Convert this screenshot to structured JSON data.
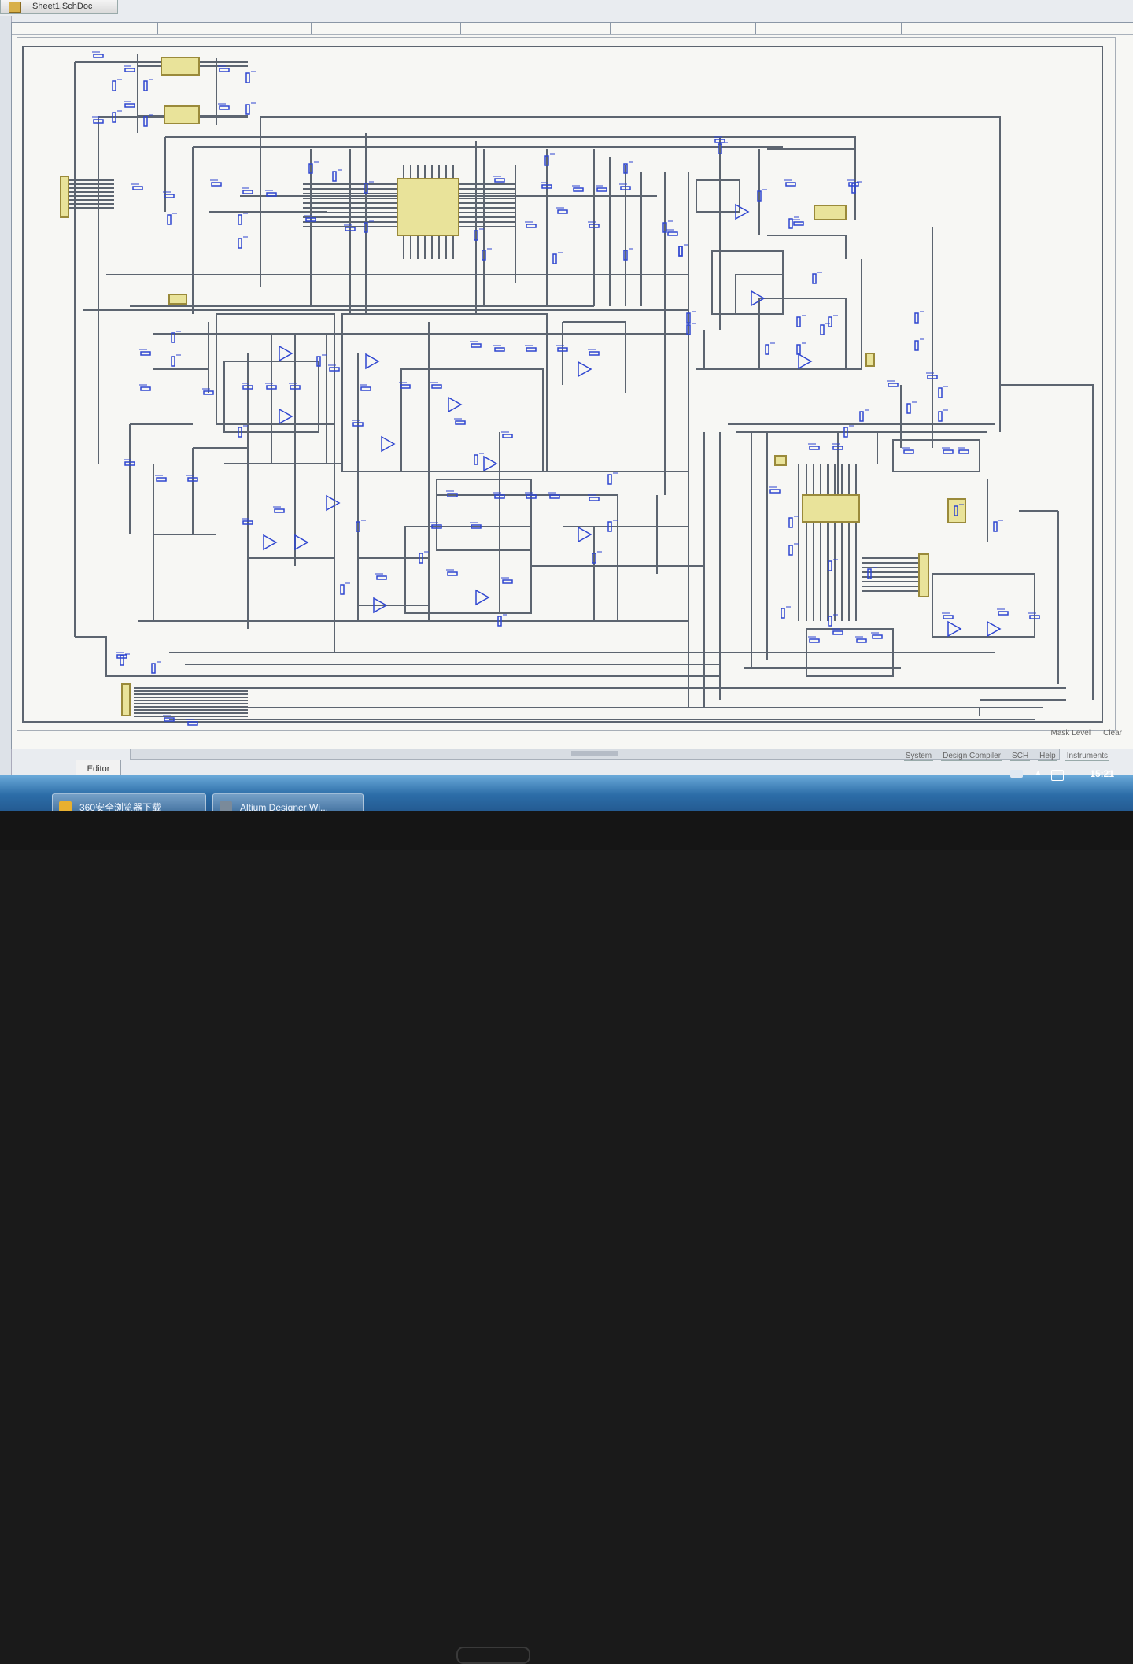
{
  "window": {
    "doc_tab_label": "Sheet1.SchDoc"
  },
  "editor": {
    "tab_label": "Editor",
    "scroll_marker": "III"
  },
  "mask_bar": {
    "mask_level": "Mask Level",
    "clear": "Clear"
  },
  "status_links": [
    "System",
    "Design Compiler",
    "SCH",
    "Help",
    "Instruments"
  ],
  "taskbar": {
    "items": [
      {
        "label": "360安全浏览器下载",
        "icon_color": "#e8b030"
      },
      {
        "label": "Altium Designer Wi...",
        "icon_color": "#7a8a9a"
      }
    ],
    "clock": "15:21"
  },
  "colors": {
    "wire": "#5d6570",
    "component": "#2f46d0",
    "ic_fill": "#e9e39a",
    "ic_stroke": "#9a8a3a",
    "label_red": "#c83a2a"
  }
}
